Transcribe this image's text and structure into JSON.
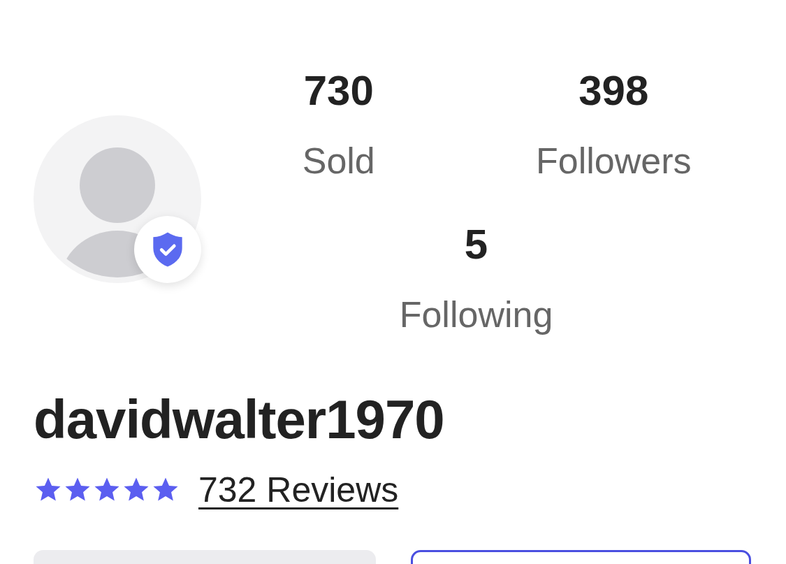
{
  "profile": {
    "verified": true,
    "username": "davidwalter1970",
    "stars": 5,
    "reviews": "732 Reviews"
  },
  "stats": [
    {
      "value": "730",
      "label": "Sold"
    },
    {
      "value": "398",
      "label": "Followers"
    },
    {
      "value": "5",
      "label": "Following"
    }
  ],
  "actions": [
    {
      "kind": "filled"
    },
    {
      "kind": "outline"
    }
  ]
}
